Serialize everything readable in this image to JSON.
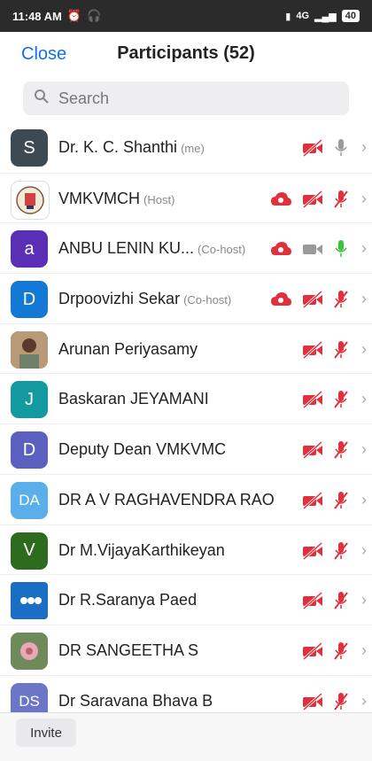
{
  "status_bar": {
    "time": "11:48 AM",
    "signal_text": "4G",
    "battery": "40"
  },
  "header": {
    "close_label": "Close",
    "title": "Participants (52)"
  },
  "search": {
    "placeholder": "Search"
  },
  "participants": [
    {
      "name": "Dr. K. C. Shanthi",
      "role": "(me)",
      "avatar_text": "S",
      "avatar_color": "#3c4a52",
      "cloud": false,
      "video": "off",
      "mic": "idle"
    },
    {
      "name": "VMKVMCH",
      "role": "(Host)",
      "avatar_text": "",
      "avatar_color": "#ffffff",
      "cloud": true,
      "video": "off",
      "mic": "muted"
    },
    {
      "name": "ANBU LENIN KU...",
      "role": "(Co-host)",
      "avatar_text": "a",
      "avatar_color": "#5b2fb5",
      "cloud": true,
      "video": "on",
      "mic": "active"
    },
    {
      "name": "Drpoovizhi Sekar",
      "role": "(Co-host)",
      "avatar_text": "D",
      "avatar_color": "#1479d4",
      "cloud": true,
      "video": "off",
      "mic": "muted"
    },
    {
      "name": "Arunan Periyasamy",
      "role": "",
      "avatar_text": "",
      "avatar_color": "#8a6a4c",
      "cloud": false,
      "video": "off",
      "mic": "muted"
    },
    {
      "name": "Baskaran JEYAMANI",
      "role": "",
      "avatar_text": "J",
      "avatar_color": "#129aa0",
      "cloud": false,
      "video": "off",
      "mic": "muted"
    },
    {
      "name": "Deputy Dean VMKVMC",
      "role": "",
      "avatar_text": "D",
      "avatar_color": "#5a5fc0",
      "cloud": false,
      "video": "off",
      "mic": "muted"
    },
    {
      "name": "DR A V RAGHAVENDRA RAO",
      "role": "",
      "avatar_text": "DA",
      "avatar_color": "#5aaee9",
      "cloud": false,
      "video": "off",
      "mic": "muted"
    },
    {
      "name": "Dr M.VijayaKarthikeyan",
      "role": "",
      "avatar_text": "V",
      "avatar_color": "#2e6b1f",
      "cloud": false,
      "video": "off",
      "mic": "muted"
    },
    {
      "name": "Dr R.Saranya Paed",
      "role": "",
      "avatar_text": "",
      "avatar_color": "#1a6fc4",
      "cloud": false,
      "video": "off",
      "mic": "muted"
    },
    {
      "name": "DR SANGEETHA S",
      "role": "",
      "avatar_text": "",
      "avatar_color": "#9c6b6b",
      "cloud": false,
      "video": "off",
      "mic": "muted"
    },
    {
      "name": "Dr Saravana Bhava B",
      "role": "",
      "avatar_text": "DS",
      "avatar_color": "#6b76c6",
      "cloud": false,
      "video": "off",
      "mic": "muted"
    }
  ],
  "footer": {
    "invite_label": "Invite"
  },
  "colors": {
    "accent": "#0e72ed",
    "muted_red": "#e0303c",
    "mic_active": "#3ac23a",
    "icon_grey": "#9a9a9a"
  }
}
